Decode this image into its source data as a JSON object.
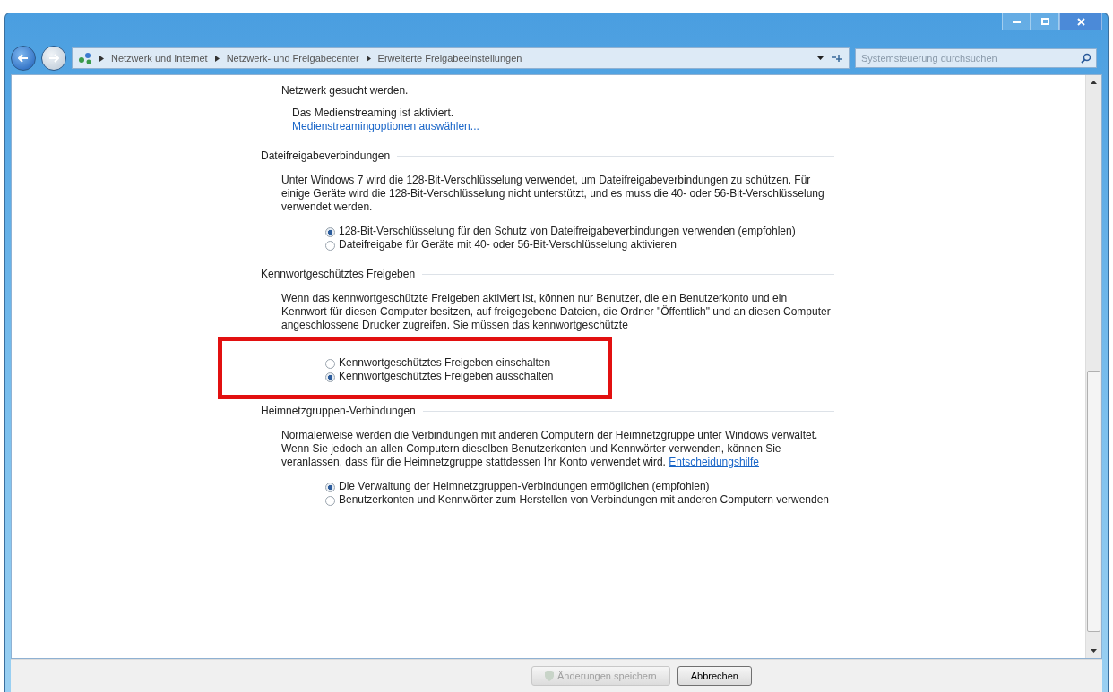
{
  "breadcrumb": [
    "Netzwerk und Internet",
    "Netzwerk- und Freigabecenter",
    "Erweiterte Freigabeeinstellungen"
  ],
  "search": {
    "placeholder": "Systemsteuerung durchsuchen"
  },
  "top_lines": [
    "Netzwerk gesucht werden."
  ],
  "streaming_status": "Das Medienstreaming ist aktiviert.",
  "streaming_link": "Medienstreamingoptionen auswählen...",
  "sections": [
    {
      "heading": "Dateifreigabeverbindungen",
      "text": "Unter Windows 7 wird die 128-Bit-Verschlüsselung verwendet, um Dateifreigabeverbindungen zu schützen. Für einige Geräte wird die 128-Bit-Verschlüsselung nicht unterstützt, und es muss die 40- oder 56-Bit-Verschlüsselung verwendet werden.",
      "options": [
        {
          "label": "128-Bit-Verschlüsselung für den Schutz von Dateifreigabeverbindungen verwenden (empfohlen)",
          "selected": true
        },
        {
          "label": "Dateifreigabe für Geräte mit 40- oder 56-Bit-Verschlüsselung aktivieren",
          "selected": false
        }
      ]
    },
    {
      "heading": "Kennwortgeschütztes Freigeben",
      "text": "Wenn das kennwortgeschützte Freigeben aktiviert ist, können nur Benutzer, die ein Benutzerkonto und ein Kennwort für diesen Computer besitzen, auf freigegebene Dateien, die Ordner \"Öffentlich\" und an diesen Computer angeschlossene Drucker zugreifen. Sie müssen das kennwortgeschützte",
      "highlighted": true,
      "options": [
        {
          "label": "Kennwortgeschütztes Freigeben einschalten",
          "selected": false
        },
        {
          "label": "Kennwortgeschütztes Freigeben ausschalten",
          "selected": true
        }
      ]
    },
    {
      "heading": "Heimnetzgruppen-Verbindungen",
      "text": "Normalerweise werden die Verbindungen mit anderen Computern der Heimnetzgruppe unter Windows verwaltet. Wenn Sie jedoch an allen Computern dieselben Benutzerkonten und Kennwörter verwenden, können Sie veranlassen, dass für die Heimnetzgruppe stattdessen Ihr Konto verwendet wird.",
      "link": "Entscheidungshilfe",
      "options": [
        {
          "label": "Die Verwaltung der Heimnetzgruppen-Verbindungen ermöglichen (empfohlen)",
          "selected": true
        },
        {
          "label": "Benutzerkonten und Kennwörter zum Herstellen von Verbindungen mit anderen Computern verwenden",
          "selected": false
        }
      ]
    }
  ],
  "buttons": [
    {
      "label": "Änderungen speichern",
      "disabled": true
    },
    {
      "label": "Abbrechen",
      "disabled": false
    }
  ]
}
